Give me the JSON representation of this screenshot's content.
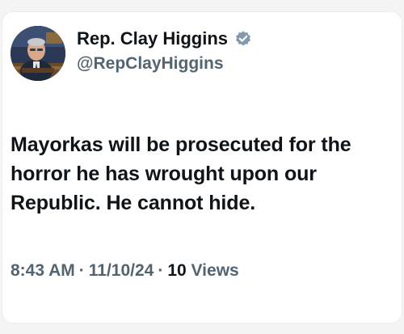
{
  "tweet": {
    "author": {
      "display_name": "Rep. Clay Higgins",
      "handle": "@RepClayHiggins",
      "verified": true,
      "verified_color": "#829aab",
      "avatar_icon": "profile-photo"
    },
    "text": "Mayorkas will be prosecuted for the horror he has wrought upon our Republic. He cannot hide.",
    "meta": {
      "time": "8:43 AM",
      "separator": "·",
      "date": "11/10/24",
      "views_count": "10",
      "views_label": "Views"
    }
  },
  "colors": {
    "primary_text": "#0f1419",
    "secondary_text": "#536471",
    "background": "#ffffff"
  }
}
